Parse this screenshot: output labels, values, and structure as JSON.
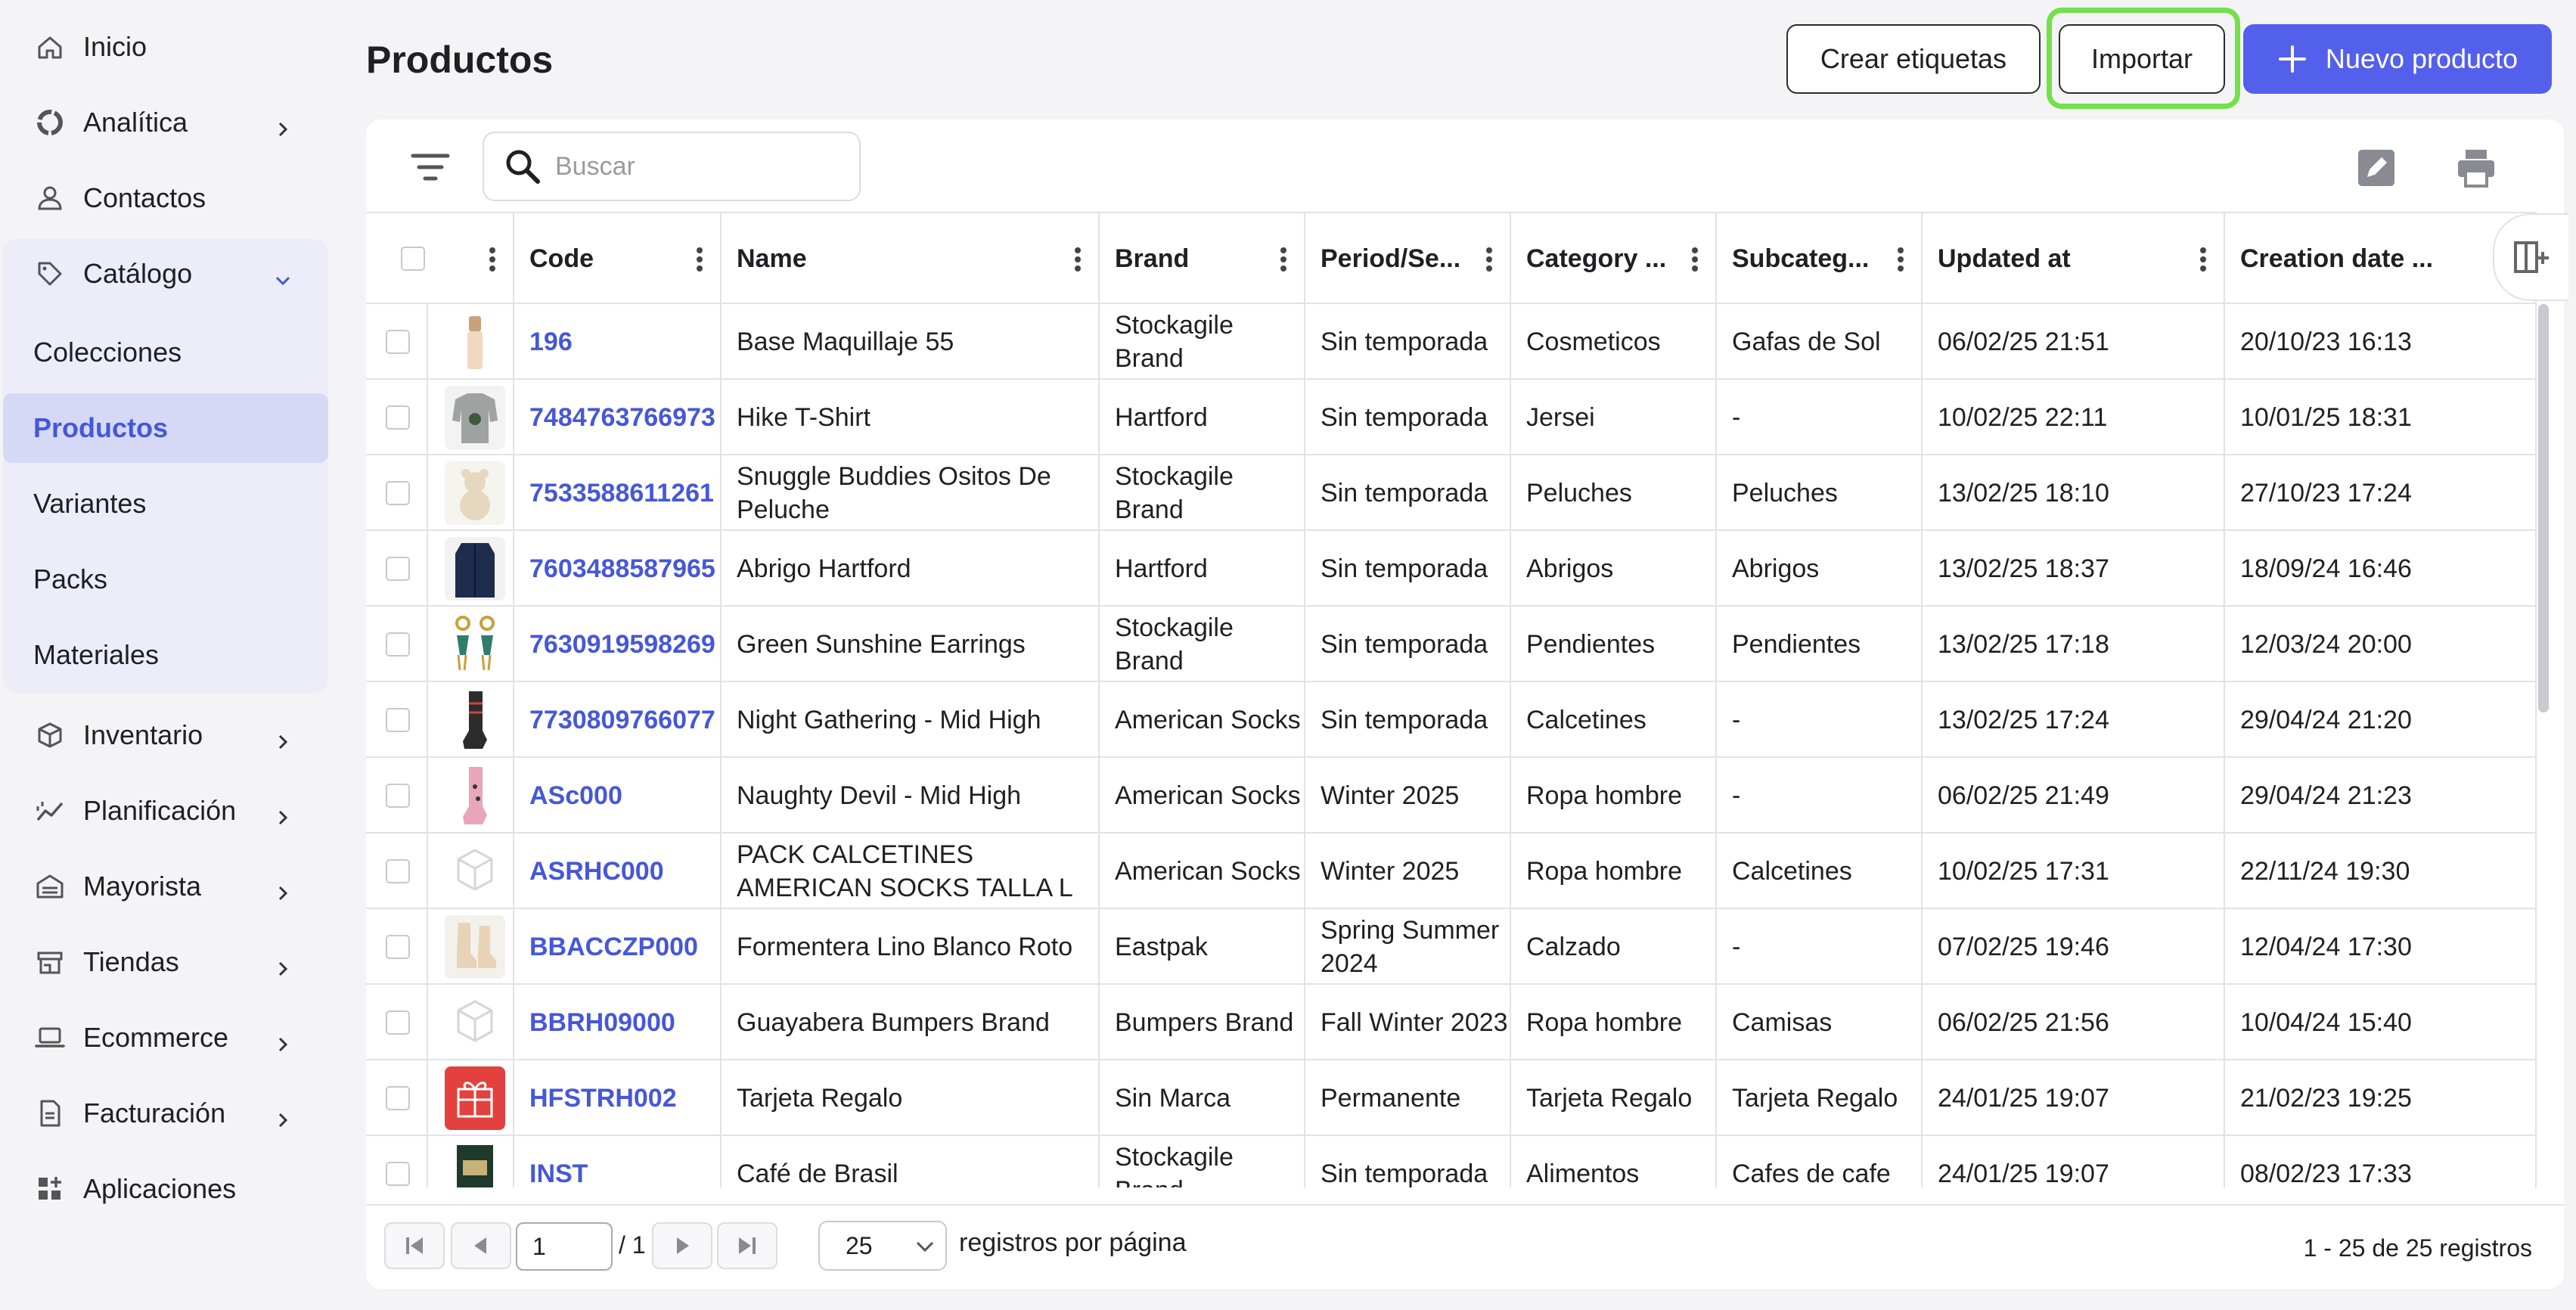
{
  "colors": {
    "accent": "#5360ec",
    "link": "#4657d8",
    "active_bg": "#d5d9f6",
    "catalog_bg": "#ecedf8",
    "highlight": "#74e04a"
  },
  "sidebar": {
    "items": [
      {
        "label": "Inicio",
        "icon": "home-icon"
      },
      {
        "label": "Analítica",
        "icon": "analytics-icon"
      },
      {
        "label": "Contactos",
        "icon": "user-icon"
      },
      {
        "label": "Catálogo",
        "icon": "tag-icon"
      },
      {
        "label": "Inventario",
        "icon": "box-icon"
      },
      {
        "label": "Planificación",
        "icon": "trend-icon"
      },
      {
        "label": "Mayorista",
        "icon": "warehouse-icon"
      },
      {
        "label": "Tiendas",
        "icon": "store-icon"
      },
      {
        "label": "Ecommerce",
        "icon": "laptop-icon"
      },
      {
        "label": "Facturación",
        "icon": "invoice-icon"
      },
      {
        "label": "Aplicaciones",
        "icon": "apps-icon"
      }
    ],
    "catalog_sub": [
      "Colecciones",
      "Productos",
      "Variantes",
      "Packs",
      "Materiales"
    ]
  },
  "header": {
    "title": "Productos",
    "btn_labels": "Crear etiquetas",
    "btn_import": "Importar",
    "btn_new": "Nuevo producto"
  },
  "search": {
    "placeholder": "Buscar"
  },
  "table": {
    "columns": [
      "Code",
      "Name",
      "Brand",
      "Period/Se...",
      "Category ...",
      "Subcateg...",
      "Updated at",
      "Creation date ..."
    ],
    "rows": [
      {
        "thumb": "foundation",
        "code": "196",
        "name": "Base Maquillaje 55",
        "brand": "Stockagile Brand",
        "period": "Sin temporada",
        "category": "Cosmeticos",
        "subcategory": "Gafas de Sol",
        "updated": "06/02/25 21:51",
        "created": "20/10/23 16:13"
      },
      {
        "thumb": "sweater",
        "code": "7484763766973",
        "name": "Hike T-Shirt",
        "brand": "Hartford",
        "period": "Sin temporada",
        "category": "Jersei",
        "subcategory": "-",
        "updated": "10/02/25 22:11",
        "created": "10/01/25 18:31"
      },
      {
        "thumb": "bear",
        "code": "7533588611261",
        "name": "Snuggle Buddies Ositos De Peluche",
        "brand": "Stockagile Brand",
        "period": "Sin temporada",
        "category": "Peluches",
        "subcategory": "Peluches",
        "updated": "13/02/25 18:10",
        "created": "27/10/23 17:24"
      },
      {
        "thumb": "coat",
        "code": "7603488587965",
        "name": "Abrigo Hartford",
        "brand": "Hartford",
        "period": "Sin temporada",
        "category": "Abrigos",
        "subcategory": "Abrigos",
        "updated": "13/02/25 18:37",
        "created": "18/09/24 16:46"
      },
      {
        "thumb": "earrings",
        "code": "7630919598269",
        "name": "Green Sunshine Earrings",
        "brand": "Stockagile Brand",
        "period": "Sin temporada",
        "category": "Pendientes",
        "subcategory": "Pendientes",
        "updated": "13/02/25 17:18",
        "created": "12/03/24 20:00"
      },
      {
        "thumb": "sock-dark",
        "code": "7730809766077",
        "name": "Night Gathering - Mid High",
        "brand": "American Socks",
        "period": "Sin temporada",
        "category": "Calcetines",
        "subcategory": "-",
        "updated": "13/02/25 17:24",
        "created": "29/04/24 21:20"
      },
      {
        "thumb": "sock-pink",
        "code": "ASc000",
        "name": "Naughty Devil - Mid High",
        "brand": "American Socks",
        "period": "Winter 2025",
        "category": "Ropa hombre",
        "subcategory": "-",
        "updated": "06/02/25 21:49",
        "created": "29/04/24 21:23"
      },
      {
        "thumb": "placeholder",
        "code": "ASRHC000",
        "name": "PACK CALCETINES AMERICAN SOCKS TALLA L",
        "brand": "American Socks",
        "period": "Winter 2025",
        "category": "Ropa hombre",
        "subcategory": "Calcetines",
        "updated": "10/02/25 17:31",
        "created": "22/11/24 19:30"
      },
      {
        "thumb": "shoes",
        "code": "BBACCZP000",
        "name": "Formentera Lino Blanco Roto",
        "brand": "Eastpak",
        "period": "Spring Summer 2024",
        "category": "Calzado",
        "subcategory": "-",
        "updated": "07/02/25 19:46",
        "created": "12/04/24 17:30"
      },
      {
        "thumb": "placeholder",
        "code": "BBRH09000",
        "name": "Guayabera Bumpers Brand",
        "brand": "Bumpers Brand",
        "period": "Fall Winter 2023",
        "category": "Ropa hombre",
        "subcategory": "Camisas",
        "updated": "06/02/25 21:56",
        "created": "10/04/24 15:40"
      },
      {
        "thumb": "gift",
        "code": "HFSTRH002",
        "name": "Tarjeta Regalo",
        "brand": "Sin Marca",
        "period": "Permanente",
        "category": "Tarjeta Regalo",
        "subcategory": "Tarjeta Regalo",
        "updated": "24/01/25 19:07",
        "created": "21/02/23 19:25"
      },
      {
        "thumb": "coffee",
        "code": "INST",
        "name": "Café de Brasil",
        "brand": "Stockagile Brand",
        "period": "Sin temporada",
        "category": "Alimentos",
        "subcategory": "Cafes de cafe",
        "updated": "24/01/25 19:07",
        "created": "08/02/23 17:33"
      }
    ]
  },
  "pagination": {
    "page": "1",
    "total_pages": "/ 1",
    "per_page": "25",
    "per_page_label": "registros por página",
    "records": "1 - 25 de 25 registros"
  }
}
